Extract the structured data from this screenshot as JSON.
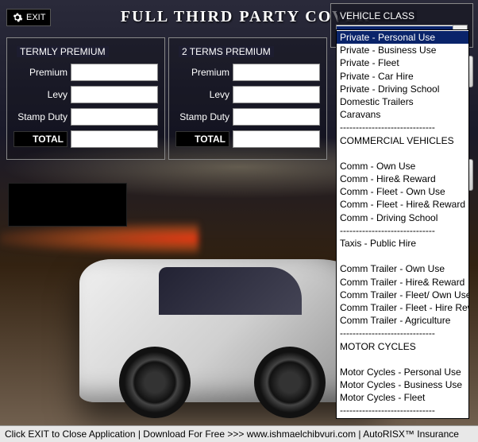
{
  "header": {
    "exit_label": "EXIT",
    "title": "FULL THIRD PARTY COVER"
  },
  "vehicle_class": {
    "label": "VEHICLE CLASS",
    "selected": "Private - Personal Use",
    "options": [
      "Private - Personal Use",
      "Private - Business Use",
      "Private - Fleet",
      "Private - Car Hire",
      "Private - Driving School",
      "Domestic Trailers",
      "Caravans",
      "------------------------------",
      "COMMERCIAL VEHICLES",
      "",
      "Comm - Own Use",
      "Comm - Hire& Reward",
      "Comm - Fleet - Own Use",
      "Comm - Fleet - Hire& Reward",
      "Comm - Driving School",
      "------------------------------",
      "Taxis - Public Hire",
      "",
      "Comm Trailer - Own Use",
      "Comm Trailer - Hire& Reward",
      "Comm Trailer - Fleet/ Own Use",
      "Comm Trailer - Fleet - Hire Reward",
      "Comm Trailer - Agriculture",
      "------------------------------",
      "MOTOR CYCLES",
      "",
      "Motor Cycles - Personal Use",
      "Motor Cycles - Business Use",
      "Motor Cycles - Fleet",
      "------------------------------"
    ]
  },
  "termly": {
    "title": "TERMLY PREMIUM",
    "premium_label": "Premium",
    "levy_label": "Levy",
    "stamp_label": "Stamp Duty",
    "total_label": "TOTAL",
    "premium_value": "",
    "levy_value": "",
    "stamp_value": "",
    "total_value": ""
  },
  "two_terms": {
    "title": "2 TERMS PREMIUM",
    "premium_label": "Premium",
    "levy_label": "Levy",
    "stamp_label": "Stamp Duty",
    "total_label": "TOTAL",
    "premium_value": "",
    "levy_value": "",
    "stamp_value": "",
    "total_value": ""
  },
  "footer": {
    "text": "Click EXIT to Close Application | Download For Free >>> www.ishmaelchibvuri.com | AutoRISX™ Insurance"
  }
}
